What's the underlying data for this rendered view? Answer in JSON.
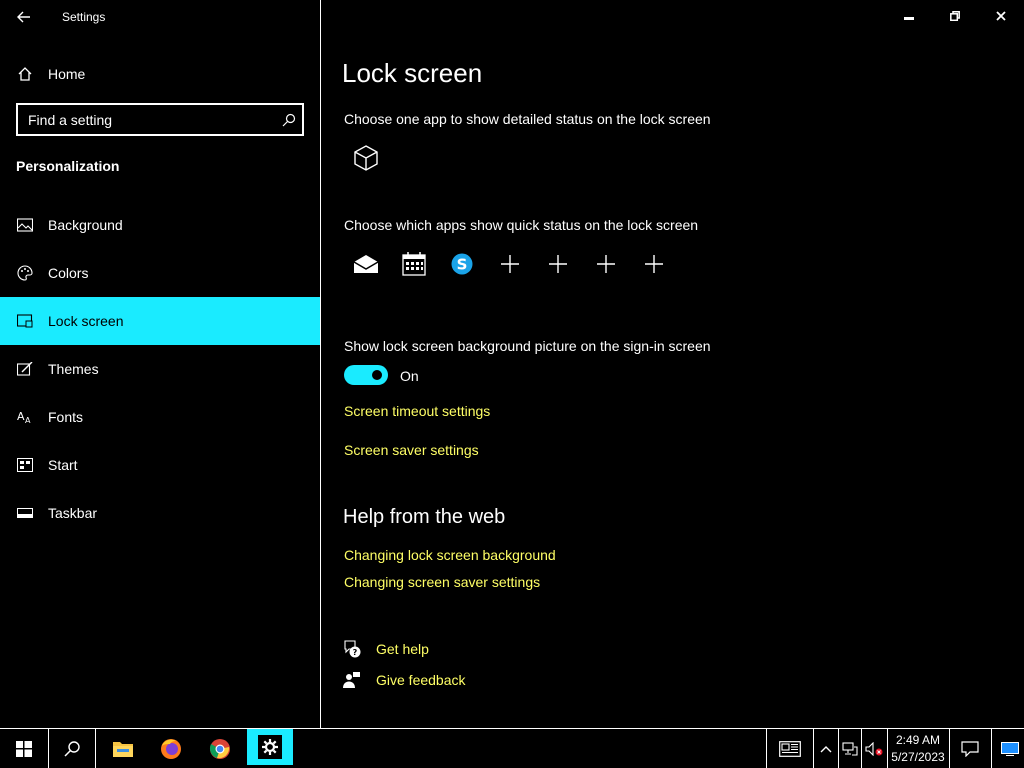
{
  "window": {
    "title": "Settings",
    "buttons": [
      "minimize",
      "restore",
      "close"
    ]
  },
  "sidebar": {
    "home_label": "Home",
    "search_placeholder": "Find a setting",
    "section_title": "Personalization",
    "items": [
      {
        "label": "Background",
        "icon": "picture-icon"
      },
      {
        "label": "Colors",
        "icon": "palette-icon"
      },
      {
        "label": "Lock screen",
        "icon": "lock-screen-icon",
        "selected": true
      },
      {
        "label": "Themes",
        "icon": "themes-icon"
      },
      {
        "label": "Fonts",
        "icon": "fonts-icon"
      },
      {
        "label": "Start",
        "icon": "start-icon"
      },
      {
        "label": "Taskbar",
        "icon": "taskbar-icon"
      }
    ]
  },
  "main": {
    "title": "Lock screen",
    "detailed_status_label": "Choose one app to show detailed status on the lock screen",
    "quick_status_label": "Choose which apps show quick status on the lock screen",
    "quick_status_apps": [
      "mail-icon",
      "calendar-icon",
      "skype-icon",
      "add-icon",
      "add-icon",
      "add-icon",
      "add-icon"
    ],
    "signin_label": "Show lock screen background picture on the sign-in screen",
    "toggle_state": "On",
    "screen_timeout_link": "Screen timeout settings",
    "screen_saver_link": "Screen saver settings",
    "help_title": "Help from the web",
    "help_links": [
      "Changing lock screen background",
      "Changing screen saver settings"
    ],
    "get_help": "Get help",
    "give_feedback": "Give feedback"
  },
  "taskbar": {
    "time": "2:49 AM",
    "date": "5/27/2023",
    "apps": [
      "start-icon",
      "search-icon",
      "file-explorer-icon",
      "firefox-icon",
      "chrome-icon",
      "settings-icon"
    ]
  },
  "colors": {
    "accent": "#1aebff",
    "link": "#ffff66",
    "background": "#000000"
  }
}
